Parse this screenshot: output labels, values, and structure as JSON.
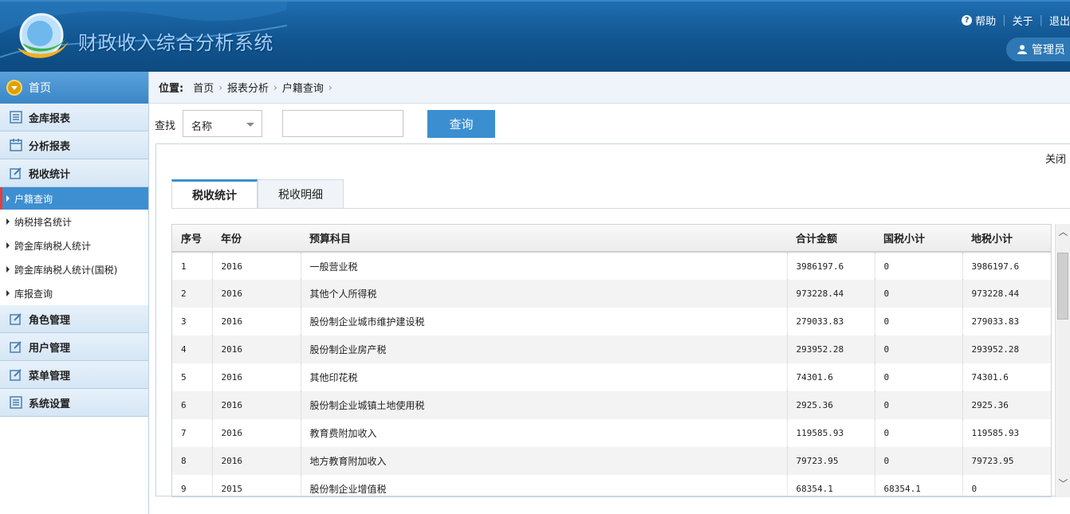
{
  "header": {
    "title": "财政收入综合分析系统",
    "links": [
      "帮助",
      "关于",
      "退出"
    ],
    "user": "管理员"
  },
  "sidebar": {
    "home": "首页",
    "groups_top": [
      {
        "label": "金库报表",
        "icon": "list-icon"
      },
      {
        "label": "分析报表",
        "icon": "calendar-icon"
      },
      {
        "label": "税收统计",
        "icon": "edit-icon"
      }
    ],
    "sub_items": [
      {
        "label": "户籍查询",
        "active": true
      },
      {
        "label": "纳税排名统计"
      },
      {
        "label": "跨金库纳税人统计"
      },
      {
        "label": "跨金库纳税人统计(国税)"
      },
      {
        "label": "库报查询"
      }
    ],
    "groups_bottom": [
      {
        "label": "角色管理",
        "icon": "edit-icon"
      },
      {
        "label": "用户管理",
        "icon": "edit-icon"
      },
      {
        "label": "菜单管理",
        "icon": "edit-icon"
      },
      {
        "label": "系统设置",
        "icon": "list-icon"
      }
    ]
  },
  "breadcrumb": {
    "label": "位置:",
    "items": [
      "首页",
      "报表分析",
      "户籍查询"
    ]
  },
  "search": {
    "label": "查找",
    "select_value": "名称",
    "input_value": "",
    "button": "查询"
  },
  "panel": {
    "close": "关闭",
    "tabs": [
      "税收统计",
      "税收明细"
    ]
  },
  "table": {
    "columns": [
      "序号",
      "年份",
      "预算科目",
      "合计金额",
      "国税小计",
      "地税小计"
    ],
    "rows": [
      [
        "1",
        "2016",
        "一般营业税",
        "3986197.6",
        "0",
        "3986197.6"
      ],
      [
        "2",
        "2016",
        "其他个人所得税",
        "973228.44",
        "0",
        "973228.44"
      ],
      [
        "3",
        "2016",
        "股份制企业城市维护建设税",
        "279033.83",
        "0",
        "279033.83"
      ],
      [
        "4",
        "2016",
        "股份制企业房产税",
        "293952.28",
        "0",
        "293952.28"
      ],
      [
        "5",
        "2016",
        "其他印花税",
        "74301.6",
        "0",
        "74301.6"
      ],
      [
        "6",
        "2016",
        "股份制企业城镇土地使用税",
        "2925.36",
        "0",
        "2925.36"
      ],
      [
        "7",
        "2016",
        "教育费附加收入",
        "119585.93",
        "0",
        "119585.93"
      ],
      [
        "8",
        "2016",
        "地方教育附加收入",
        "79723.95",
        "0",
        "79723.95"
      ],
      [
        "9",
        "2015",
        "股份制企业增值税",
        "68354.1",
        "68354.1",
        "0"
      ]
    ]
  }
}
